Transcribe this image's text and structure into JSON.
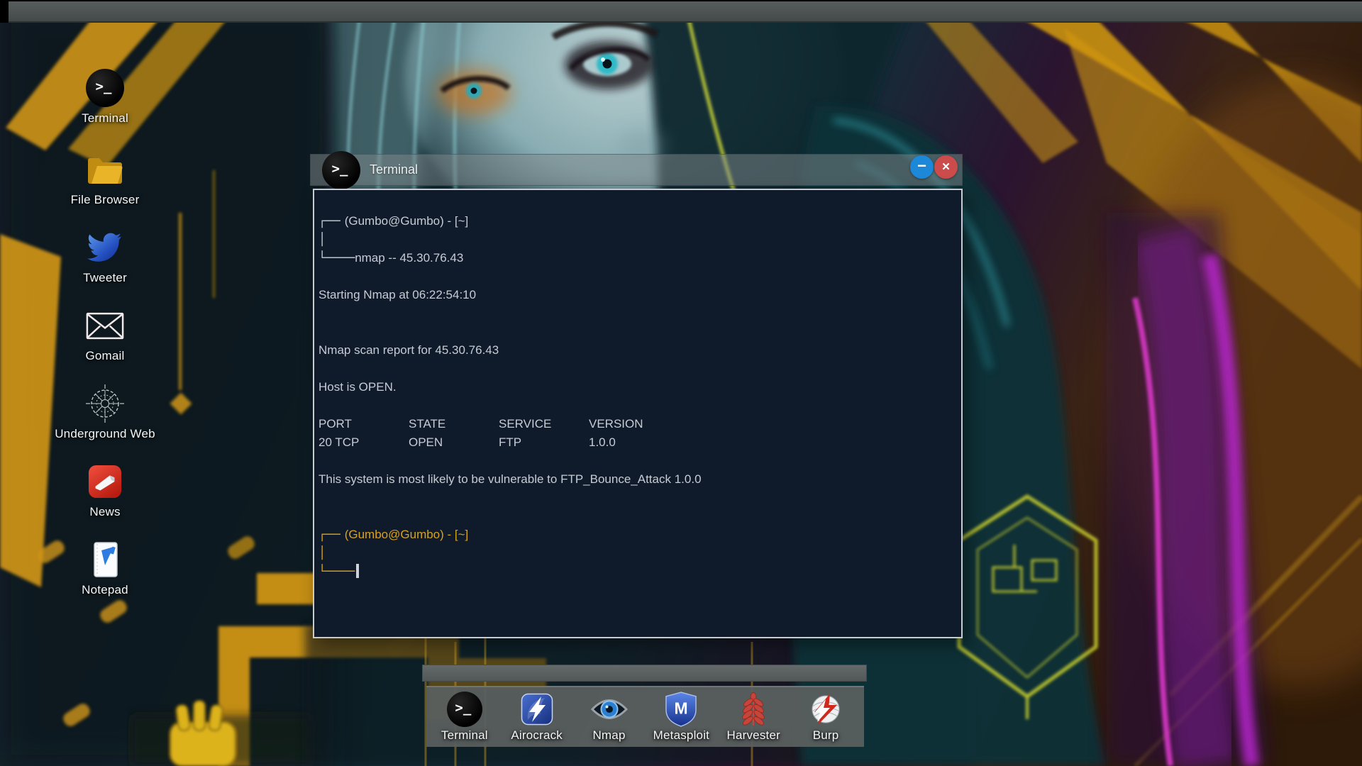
{
  "glyphs": {
    "terminal_prompt": ">_",
    "minimize": "−",
    "close": "✕",
    "metasploit_letter": "M"
  },
  "colors": {
    "terminal_background": "#0f1a2a",
    "terminal_text": "#c6ccd4",
    "prompt_highlight": "#d9a21b",
    "titlebar_gray": "#7e888a",
    "minimize_button": "#1e88d8",
    "close_button": "#cc4b4b",
    "dock_gray": "#5a605f",
    "wallpaper_amber": "#cf9516",
    "wallpaper_magenta": "#c026d8",
    "wallpaper_teal": "#2fb9c6"
  },
  "desktop_icons": [
    {
      "label": "Terminal"
    },
    {
      "label": "File Browser"
    },
    {
      "label": "Tweeter"
    },
    {
      "label": "Gomail"
    },
    {
      "label": "Underground Web"
    },
    {
      "label": "News"
    },
    {
      "label": "Notepad"
    }
  ],
  "window": {
    "title": "Terminal"
  },
  "terminal": {
    "prompt1": {
      "box_top": "┌──",
      "user": "(Gumbo@Gumbo) - [~]",
      "box_mid": "│",
      "box_bottom": "└────",
      "command": "nmap -- 45.30.76.43"
    },
    "lines": {
      "starting": "Starting Nmap at 06:22:54:10",
      "report": "Nmap scan report for 45.30.76.43",
      "host": "Host is OPEN.",
      "vulnerability": "This system is most likely to be vulnerable to FTP_Bounce_Attack 1.0.0"
    },
    "table": {
      "headers": [
        "PORT",
        "STATE",
        "SERVICE",
        "VERSION"
      ],
      "row": [
        "20 TCP",
        "OPEN",
        "FTP",
        "1.0.0"
      ]
    },
    "prompt2": {
      "box_top": "┌──",
      "user": "(Gumbo@Gumbo) - [~]",
      "box_mid": "│",
      "box_bottom": "└────"
    }
  },
  "dock_items": [
    {
      "label": "Terminal"
    },
    {
      "label": "Airocrack"
    },
    {
      "label": "Nmap"
    },
    {
      "label": "Metasploit"
    },
    {
      "label": "Harvester"
    },
    {
      "label": "Burp"
    }
  ]
}
